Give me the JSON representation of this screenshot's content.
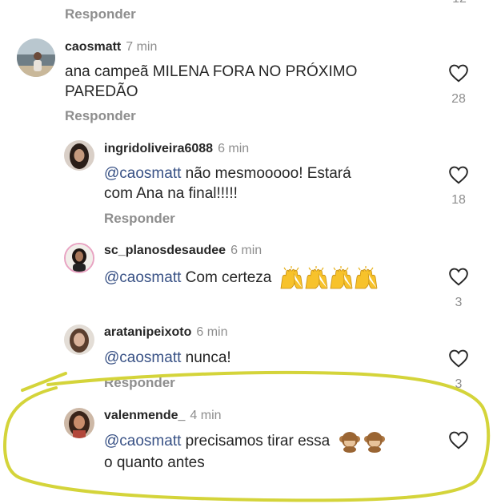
{
  "top": {
    "reply_label": "Responder",
    "likes_partial": "12"
  },
  "comments": [
    {
      "username": "caosmatt",
      "time": "7 min",
      "text": "ana campeã MILENA FORA NO PRÓXIMO PAREDÃO",
      "reply_label": "Responder",
      "likes": "28"
    },
    {
      "username": "ingridoliveira6088",
      "time": "6 min",
      "mention": "@caosmatt",
      "text_line1": " não mesmooooo! Estará",
      "text_line2": "com Ana na final!!!!!",
      "reply_label": "Responder",
      "likes": "18"
    },
    {
      "username": "sc_planosdesaudee",
      "time": "6 min",
      "mention": "@caosmatt",
      "text": " Com certeza",
      "emoji": "raising-hands-emoji",
      "emoji_count": 4,
      "likes": "3"
    },
    {
      "username": "aratanipeixoto",
      "time": "6 min",
      "mention": "@caosmatt",
      "text": " nunca!",
      "reply_label": "Responder",
      "likes": "3"
    },
    {
      "username": "valenmende_",
      "time": "4 min",
      "mention": "@caosmatt",
      "text_line1": " precisamos tirar essa",
      "text_line2": "o quanto antes",
      "emoji": "see-no-evil-monkey-emoji",
      "emoji_count": 2
    }
  ],
  "colors": {
    "highlight": "#d4d43a",
    "mention": "#385185",
    "muted": "#8e8e8e"
  }
}
